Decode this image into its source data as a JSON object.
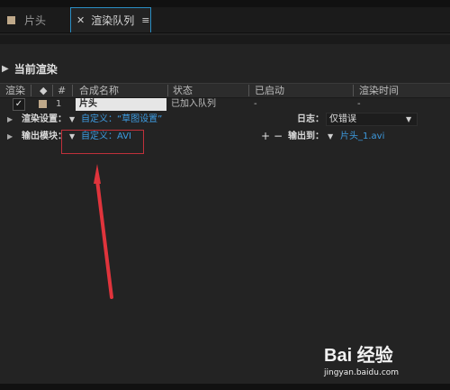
{
  "tabs": [
    {
      "label": "片头",
      "active": false
    },
    {
      "label": "渲染队列",
      "active": true
    }
  ],
  "section": {
    "title": "当前渲染"
  },
  "table": {
    "headers": [
      "渲染",
      "#",
      "合成名称",
      "状态",
      "已启动",
      "渲染时间"
    ],
    "row": {
      "checked": "✓",
      "number": "1",
      "comp_name": "片头",
      "status": "已加入队列",
      "started": "-",
      "render_time": "-"
    }
  },
  "render_settings": {
    "label": "渲染设置：",
    "value": "自定义：“草图设置”",
    "log_label": "日志：",
    "log_value": "仅错误"
  },
  "output_module": {
    "label": "输出模块：",
    "value": "自定义：AVI",
    "plus": "+",
    "minus": "−",
    "output_label": "输出到：",
    "output_value": "片头_1.avi"
  },
  "watermark": {
    "logo": "Bai 经验",
    "url": "jingyan.baidu.com"
  },
  "colors": {
    "accent": "#2a8ec4",
    "link": "#3d9be0",
    "annotation": "#e0343c"
  }
}
